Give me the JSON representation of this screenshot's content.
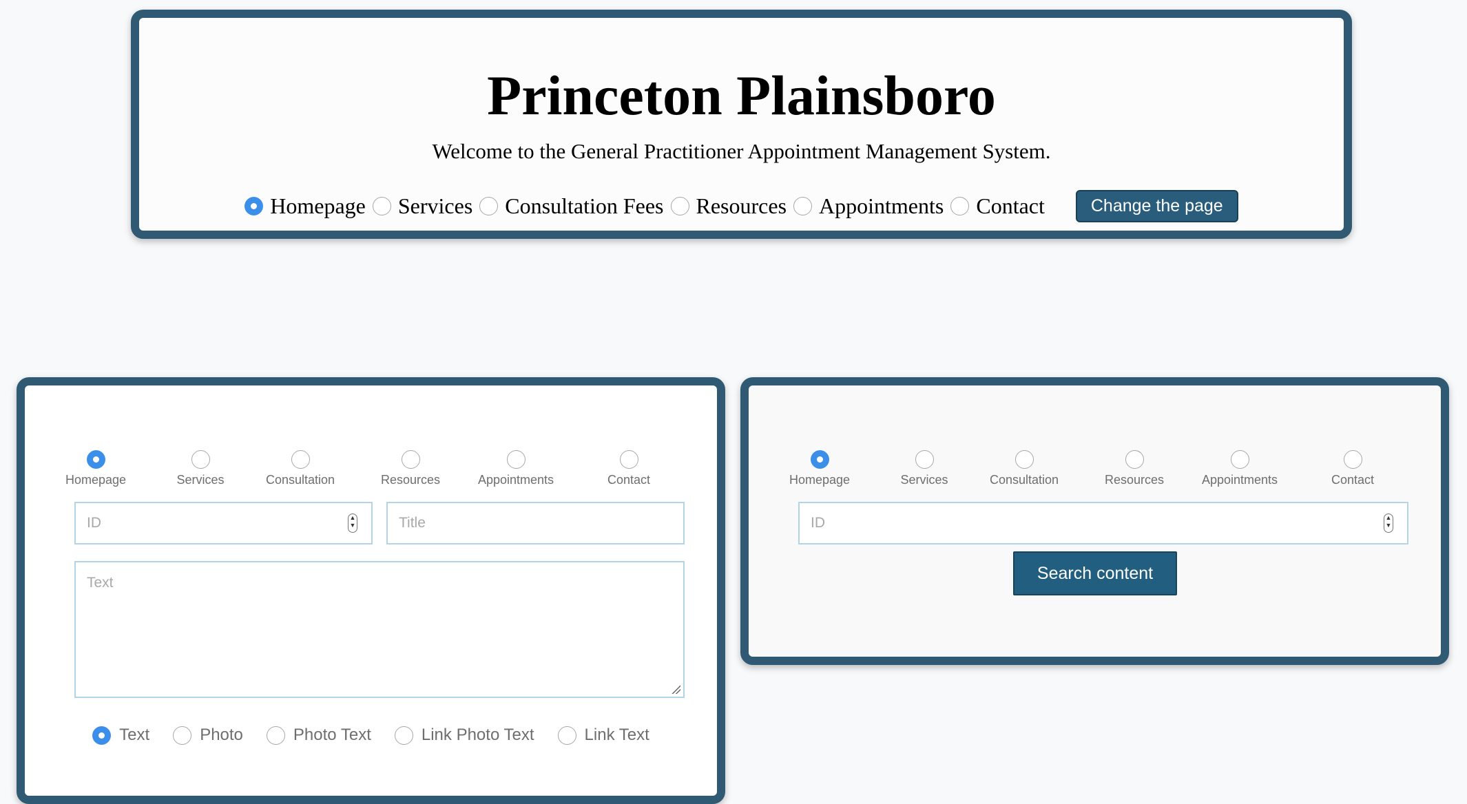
{
  "header": {
    "title": "Princeton Plainsboro",
    "subtitle": "Welcome to the General Practitioner Appointment Management System.",
    "nav": [
      {
        "label": "Homepage",
        "checked": true
      },
      {
        "label": "Services",
        "checked": false
      },
      {
        "label": "Consultation Fees",
        "checked": false
      },
      {
        "label": "Resources",
        "checked": false
      },
      {
        "label": "Appointments",
        "checked": false
      },
      {
        "label": "Contact",
        "checked": false
      }
    ],
    "change_button": "Change the page"
  },
  "editor": {
    "pages": [
      {
        "label": "Homepage",
        "checked": true
      },
      {
        "label": "Services",
        "checked": false
      },
      {
        "label": "Consultation",
        "checked": false
      },
      {
        "label": "Resources",
        "checked": false
      },
      {
        "label": "Appointments",
        "checked": false
      },
      {
        "label": "Contact",
        "checked": false
      }
    ],
    "id_placeholder": "ID",
    "title_placeholder": "Title",
    "text_placeholder": "Text",
    "types": [
      {
        "label": "Text",
        "checked": true
      },
      {
        "label": "Photo",
        "checked": false
      },
      {
        "label": "Photo Text",
        "checked": false
      },
      {
        "label": "Link Photo Text",
        "checked": false
      },
      {
        "label": "Link Text",
        "checked": false
      }
    ]
  },
  "search": {
    "pages": [
      {
        "label": "Homepage",
        "checked": true
      },
      {
        "label": "Services",
        "checked": false
      },
      {
        "label": "Consultation",
        "checked": false
      },
      {
        "label": "Resources",
        "checked": false
      },
      {
        "label": "Appointments",
        "checked": false
      },
      {
        "label": "Contact",
        "checked": false
      }
    ],
    "id_placeholder": "ID",
    "search_button": "Search content"
  },
  "colors": {
    "panel_border": "#305a73",
    "button": "#2a5c7c",
    "radio_checked": "#3b8fe8",
    "field_border": "#b3d4e6"
  }
}
